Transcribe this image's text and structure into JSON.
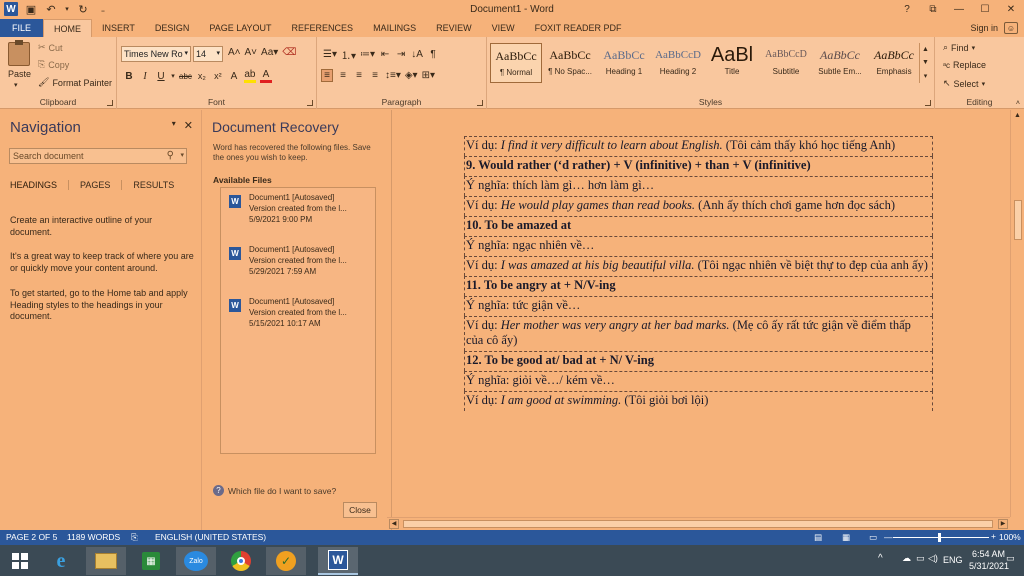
{
  "title_bar": {
    "title": "Document1 - Word",
    "qa_icons": [
      "word-logo",
      "save-icon",
      "undo-icon",
      "redo-icon",
      "customize-icon"
    ],
    "controls": [
      "?",
      "⧉",
      "—",
      "☐",
      "✕"
    ]
  },
  "tabs": {
    "file": "FILE",
    "items": [
      "HOME",
      "INSERT",
      "DESIGN",
      "PAGE LAYOUT",
      "REFERENCES",
      "MAILINGS",
      "REVIEW",
      "VIEW",
      "FOXIT READER PDF"
    ],
    "active": "HOME",
    "signin": "Sign in"
  },
  "ribbon": {
    "clipboard": {
      "label": "Clipboard",
      "paste": "Paste",
      "cut": "Cut",
      "copy": "Copy",
      "format_painter": "Format Painter"
    },
    "font": {
      "label": "Font",
      "name": "Times New Ro",
      "size": "14"
    },
    "paragraph": {
      "label": "Paragraph"
    },
    "styles": {
      "label": "Styles",
      "items": [
        {
          "sample": "AaBbCc",
          "name": "¶ Normal"
        },
        {
          "sample": "AaBbCc",
          "name": "¶ No Spac..."
        },
        {
          "sample": "AaBbCc",
          "name": "Heading 1"
        },
        {
          "sample": "AaBbCcD",
          "name": "Heading 2"
        },
        {
          "sample": "AaBl",
          "name": "Title"
        },
        {
          "sample": "AaBbCcD",
          "name": "Subtitle"
        },
        {
          "sample": "AaBbCc",
          "name": "Subtle Em..."
        },
        {
          "sample": "AaBbCc",
          "name": "Emphasis"
        }
      ]
    },
    "editing": {
      "label": "Editing",
      "find": "Find",
      "replace": "Replace",
      "select": "Select"
    }
  },
  "navigation": {
    "title": "Navigation",
    "search_placeholder": "Search document",
    "tabs": [
      "HEADINGS",
      "PAGES",
      "RESULTS"
    ],
    "p1": "Create an interactive outline of your document.",
    "p2": "It's a great way to keep track of where you are or quickly move your content around.",
    "p3": "To get started, go to the Home tab and apply Heading styles to the headings in your document."
  },
  "recovery": {
    "title": "Document Recovery",
    "subtitle": "Word has recovered the following files. Save the ones you wish to keep.",
    "available": "Available Files",
    "files": [
      {
        "name": "Document1  [Autosaved]",
        "desc": "Version created from the l...",
        "time": "5/9/2021 9:00 PM"
      },
      {
        "name": "Document1  [Autosaved]",
        "desc": "Version created from the l...",
        "time": "5/29/2021 7:59 AM"
      },
      {
        "name": "Document1  [Autosaved]",
        "desc": "Version created from the l...",
        "time": "5/15/2021 10:17 AM"
      }
    ],
    "help": "Which file do I want to save?",
    "close": "Close"
  },
  "document": {
    "rows": [
      {
        "type": "mixed",
        "label": "Ví dụ: ",
        "italic": "I find it very difficult to learn about English.",
        "rest": " (Tôi cảm thấy khó học tiếng Anh)"
      },
      {
        "type": "bold",
        "text": "9.  Would rather (‘d rather) + V (infinitive) + than + V (infinitive)"
      },
      {
        "type": "plain",
        "text": "Ý nghĩa: thích làm gì… hơn làm gì…"
      },
      {
        "type": "mixed",
        "label": "Ví dụ: ",
        "italic": "He would play games than read books.",
        "rest": " (Anh ấy thích chơi game hơn đọc sách)"
      },
      {
        "type": "bold",
        "text": "10. To be amazed at"
      },
      {
        "type": "plain",
        "text": "Ý nghĩa: ngạc nhiên về…"
      },
      {
        "type": "mixed",
        "label": "Ví dụ: ",
        "italic": "I was amazed at his big beautiful villa.",
        "rest": " (Tôi ngạc nhiên về biệt thự to đẹp của anh ấy)"
      },
      {
        "type": "bold",
        "text": "11. To be angry at + N/V-ing"
      },
      {
        "type": "plain",
        "text": "Ý nghĩa: tức giận về…"
      },
      {
        "type": "mixed",
        "label": "Ví dụ: ",
        "italic": "Her mother was very angry at her bad marks.",
        "rest": " (Mẹ cô ấy rất tức giận về điểm thấp của cô ấy)"
      },
      {
        "type": "bold",
        "text": "12. To be good at/ bad at + N/ V-ing"
      },
      {
        "type": "plain",
        "text": "Ý nghĩa: giỏi về…/ kém về…"
      },
      {
        "type": "mixed",
        "label": "Ví dụ: ",
        "italic": "I am good at swimming.",
        "rest": " (Tôi giỏi bơi lội)"
      }
    ]
  },
  "status": {
    "page": "PAGE 2 OF 5",
    "words": "1189 WORDS",
    "language": "ENGLISH (UNITED STATES)",
    "zoom": "100%"
  },
  "taskbar": {
    "apps": [
      "windows-start",
      "internet-explorer",
      "file-explorer",
      "store",
      "zalo",
      "chrome",
      "unikey",
      "word"
    ],
    "lang": "ENG",
    "time": "6:54 AM",
    "date": "5/31/2021"
  },
  "colors": {
    "accent": "#2b579a",
    "background": "#f6b27a",
    "ribbon": "#f9c79e",
    "taskbar": "#3b4a55"
  }
}
